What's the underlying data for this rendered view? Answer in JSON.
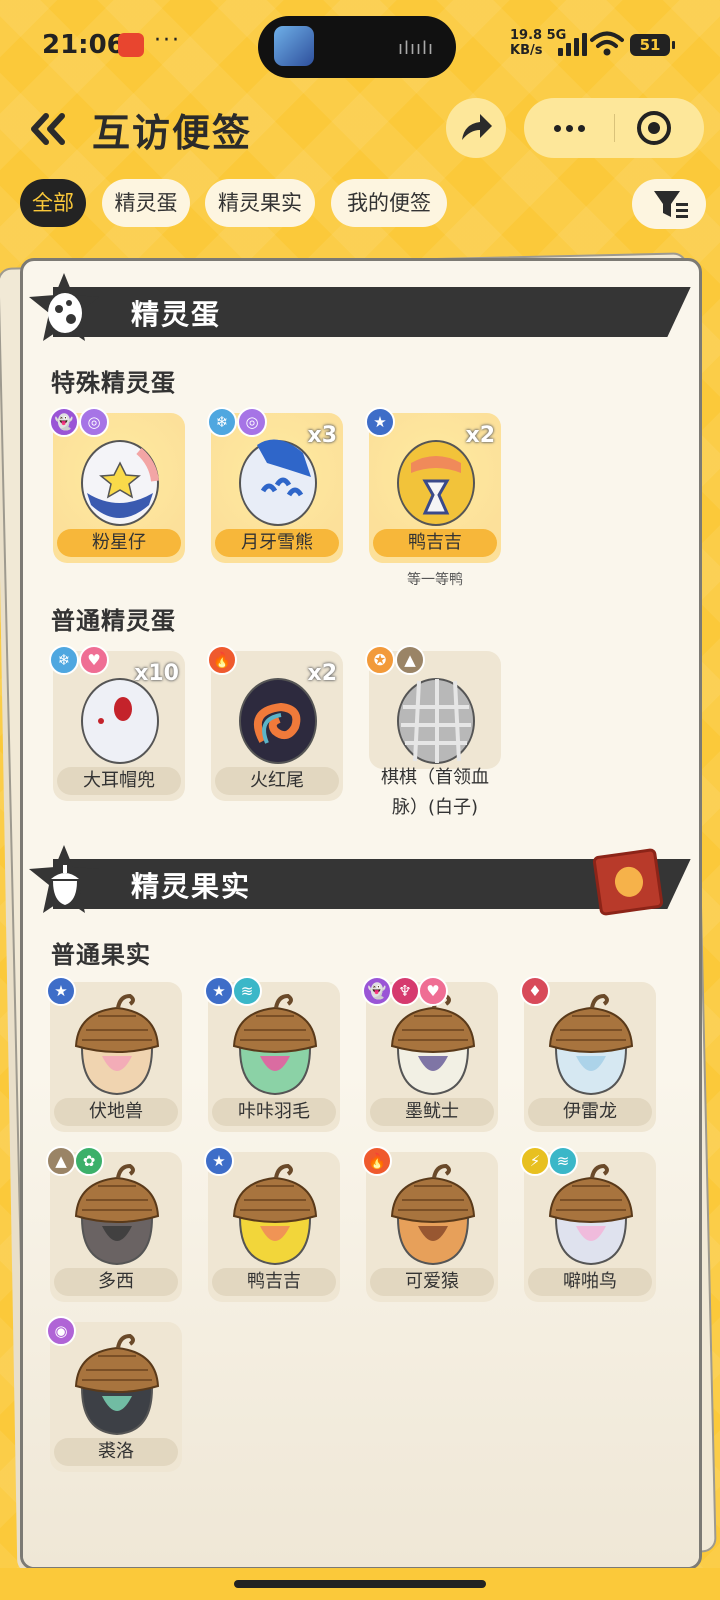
{
  "status_bar": {
    "time": "21:06",
    "dots": "···",
    "speed_top": "19.8",
    "speed_unit": "KB/s",
    "network": "5G",
    "battery": "51",
    "wifi_label": "6"
  },
  "header": {
    "title": "互访便签"
  },
  "tabs": [
    {
      "label": "全部",
      "active": true
    },
    {
      "label": "精灵蛋",
      "active": false
    },
    {
      "label": "精灵果实",
      "active": false
    },
    {
      "label": "我的便签",
      "active": false
    }
  ],
  "sections": {
    "eggs": {
      "title": "精灵蛋",
      "special_heading": "特殊精灵蛋",
      "special_items": [
        {
          "name": "粉星仔",
          "count": "",
          "types": [
            "ghost",
            "swirl"
          ]
        },
        {
          "name": "月牙雪熊",
          "count": "x3",
          "types": [
            "ice",
            "swirl"
          ]
        },
        {
          "name": "鸭吉吉",
          "count": "x2",
          "types": [
            "normal"
          ],
          "subtitle": "等一等鸭"
        }
      ],
      "normal_heading": "普通精灵蛋",
      "normal_items": [
        {
          "name": "大耳帽兜",
          "count": "x10",
          "types": [
            "ice",
            "heart"
          ]
        },
        {
          "name": "火红尾",
          "count": "x2",
          "types": [
            "fire"
          ]
        },
        {
          "name": "棋棋（首领血脉）(白子)",
          "name_line1": "棋棋（首领血",
          "name_line2": "脉）(白子)",
          "count": "",
          "types": [
            "fighting",
            "mountain"
          ]
        }
      ]
    },
    "fruits": {
      "title": "精灵果实",
      "normal_heading": "普通果实",
      "items": [
        {
          "name": "伏地兽",
          "types": [
            "normal"
          ]
        },
        {
          "name": "咔咔羽毛",
          "types": [
            "normal",
            "wind"
          ]
        },
        {
          "name": "墨鱿士",
          "types": [
            "ghost",
            "demon",
            "heart"
          ]
        },
        {
          "name": "伊雷龙",
          "types": [
            "dragon"
          ]
        },
        {
          "name": "多西",
          "types": [
            "mountain",
            "grass"
          ]
        },
        {
          "name": "鸭吉吉",
          "types": [
            "normal"
          ]
        },
        {
          "name": "可爱猿",
          "types": [
            "fire"
          ]
        },
        {
          "name": "噼啪鸟",
          "types": [
            "electric",
            "wind"
          ]
        },
        {
          "name": "裘洛",
          "types": [
            "poison"
          ]
        }
      ]
    }
  },
  "colors": {
    "background": "#fbc93a",
    "card": "#faf6ec",
    "banner": "#353535",
    "tab_active_bg": "#232323",
    "tab_active_text": "#fbc93a",
    "golden_item": "#fce09a"
  }
}
